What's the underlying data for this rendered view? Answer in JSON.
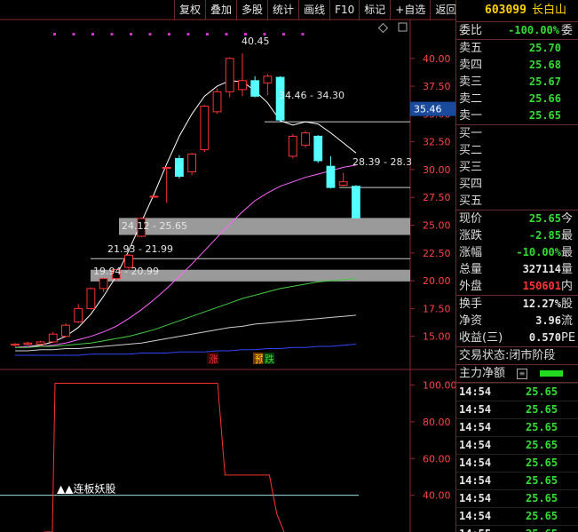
{
  "toolbar": {
    "buttons": [
      "复权",
      "叠加",
      "多股",
      "统计",
      "画线",
      "F10",
      "标记",
      "+自选",
      "返回"
    ]
  },
  "stock": {
    "code": "603099",
    "name": "长白山"
  },
  "order_book": {
    "ratio_label": "委比",
    "ratio_value": "-100.00%",
    "ratio_extra": "委",
    "asks": [
      {
        "label": "卖五",
        "price": "25.70"
      },
      {
        "label": "卖四",
        "price": "25.68"
      },
      {
        "label": "卖三",
        "price": "25.67"
      },
      {
        "label": "卖二",
        "price": "25.66"
      },
      {
        "label": "卖一",
        "price": "25.65"
      }
    ],
    "bids": [
      {
        "label": "买一",
        "price": ""
      },
      {
        "label": "买二",
        "price": ""
      },
      {
        "label": "买三",
        "price": ""
      },
      {
        "label": "买四",
        "price": ""
      },
      {
        "label": "买五",
        "price": ""
      }
    ]
  },
  "quote": [
    {
      "label": "现价",
      "value": "25.65",
      "extra": "今",
      "cls": "dn"
    },
    {
      "label": "涨跌",
      "value": "-2.85",
      "extra": "最",
      "cls": "dn"
    },
    {
      "label": "涨幅",
      "value": "-10.00%",
      "extra": "最",
      "cls": "dn"
    },
    {
      "label": "总量",
      "value": "327114",
      "extra": "量",
      "cls": "wh"
    },
    {
      "label": "外盘",
      "value": "150601",
      "extra": "内",
      "cls": "up"
    }
  ],
  "stats": [
    {
      "label": "换手",
      "value": "12.27%",
      "extra": "股"
    },
    {
      "label": "净资",
      "value": "3.96",
      "extra": "流"
    },
    {
      "label": "收益(三)",
      "value": "0.570",
      "extra": "PE"
    }
  ],
  "status_label": "交易状态:",
  "status_value": "闭市阶段",
  "flow_label": "主力净额",
  "colors": {
    "up": "#ff3333",
    "down": "#33dd33",
    "accent": "#ffd200",
    "border": "#6b2a2a"
  },
  "ticks": [
    {
      "time": "14:54",
      "price": "25.65"
    },
    {
      "time": "14:54",
      "price": "25.65"
    },
    {
      "time": "14:54",
      "price": "25.65"
    },
    {
      "time": "14:54",
      "price": "25.65"
    },
    {
      "time": "14:54",
      "price": "25.65"
    },
    {
      "time": "14:54",
      "price": "25.65"
    },
    {
      "time": "14:54",
      "price": "25.65"
    },
    {
      "time": "14:54",
      "price": "25.65"
    },
    {
      "time": "14:55",
      "price": "25.65"
    }
  ],
  "chart_data": {
    "type": "candlestick",
    "ylim": [
      12.5,
      41.5
    ],
    "yticks": [
      "15.00",
      "17.50",
      "20.00",
      "22.50",
      "25.00",
      "27.50",
      "30.00",
      "32.50",
      "35.00",
      "37.50",
      "40.00"
    ],
    "current_price_tag": "35.46",
    "candles": [
      {
        "o": 14.2,
        "c": 14.3,
        "h": 14.4,
        "l": 14.1
      },
      {
        "o": 14.3,
        "c": 14.4,
        "h": 14.5,
        "l": 14.2
      },
      {
        "o": 14.3,
        "c": 14.5,
        "h": 14.6,
        "l": 14.2
      },
      {
        "o": 14.5,
        "c": 15.2,
        "h": 15.4,
        "l": 14.4
      },
      {
        "o": 15.0,
        "c": 16.0,
        "h": 16.2,
        "l": 14.9
      },
      {
        "o": 16.3,
        "c": 17.5,
        "h": 17.9,
        "l": 16.2
      },
      {
        "o": 17.5,
        "c": 19.3,
        "h": 19.4,
        "l": 17.4
      },
      {
        "o": 19.3,
        "c": 20.2,
        "h": 20.3,
        "l": 19.0
      },
      {
        "o": 20.2,
        "c": 21.0,
        "h": 21.0,
        "l": 20.0
      },
      {
        "o": 21.2,
        "c": 22.3,
        "h": 22.4,
        "l": 21.0
      },
      {
        "o": 24.0,
        "c": 25.6,
        "h": 25.7,
        "l": 23.9
      },
      {
        "o": 27.6,
        "c": 27.6,
        "h": 27.6,
        "l": 27.6
      },
      {
        "o": 30.2,
        "c": 30.2,
        "h": 30.2,
        "l": 27.0
      },
      {
        "o": 31.0,
        "c": 29.4,
        "h": 31.3,
        "l": 29.2
      },
      {
        "o": 29.8,
        "c": 31.4,
        "h": 31.5,
        "l": 29.5
      },
      {
        "o": 31.8,
        "c": 35.7,
        "h": 35.8,
        "l": 31.6
      },
      {
        "o": 35.2,
        "c": 37.0,
        "h": 37.3,
        "l": 35.0
      },
      {
        "o": 37.0,
        "c": 40.0,
        "h": 40.1,
        "l": 36.5
      },
      {
        "o": 37.2,
        "c": 38.0,
        "h": 40.45,
        "l": 36.6
      },
      {
        "o": 38.0,
        "c": 36.6,
        "h": 38.4,
        "l": 36.5
      },
      {
        "o": 37.8,
        "c": 38.4,
        "h": 38.6,
        "l": 36.7
      },
      {
        "o": 38.3,
        "c": 34.46,
        "h": 38.4,
        "l": 34.3
      },
      {
        "o": 31.2,
        "c": 33.0,
        "h": 33.2,
        "l": 31.0
      },
      {
        "o": 32.2,
        "c": 33.3,
        "h": 33.5,
        "l": 32.0
      },
      {
        "o": 33.0,
        "c": 30.8,
        "h": 33.1,
        "l": 30.6
      },
      {
        "o": 30.3,
        "c": 28.39,
        "h": 31.2,
        "l": 28.3
      },
      {
        "o": 28.6,
        "c": 28.9,
        "h": 29.7,
        "l": 28.5
      },
      {
        "o": 28.5,
        "c": 25.65,
        "h": 28.6,
        "l": 25.65
      }
    ],
    "annotations": [
      "40.45",
      "34.46 - 34.30",
      "28.39 - 28.3",
      "24.12 - 25.65",
      "21.93 - 21.99",
      "19.94 - 20.99"
    ],
    "bands": [
      {
        "from": 24.12,
        "to": 25.65
      },
      {
        "from": 19.94,
        "to": 20.99
      }
    ],
    "ref_lines": [
      34.3,
      28.39,
      21.99
    ],
    "ma_lines": [
      {
        "color": "#ffffff",
        "values": [
          14.0,
          14.1,
          14.2,
          14.5,
          15.0,
          15.8,
          17.0,
          18.6,
          20.4,
          22.7,
          25.3,
          27.8,
          30.5,
          33.0,
          35.0,
          36.6,
          37.5,
          38.0,
          37.9,
          37.1,
          36.0,
          34.4,
          34.0,
          34.3,
          34.1,
          33.3,
          32.4,
          31.5
        ]
      },
      {
        "color": "#ff66ff",
        "values": [
          14.0,
          14.1,
          14.1,
          14.2,
          14.4,
          14.7,
          15.0,
          15.4,
          15.9,
          16.6,
          17.4,
          18.3,
          19.3,
          20.4,
          21.5,
          22.7,
          23.9,
          25.1,
          26.2,
          27.2,
          27.9,
          28.5,
          28.9,
          29.3,
          29.6,
          29.9,
          30.2,
          30.4
        ]
      },
      {
        "color": "#44cc44",
        "values": [
          14.0,
          14.0,
          14.1,
          14.1,
          14.2,
          14.3,
          14.4,
          14.6,
          14.8,
          15.0,
          15.3,
          15.6,
          16.0,
          16.4,
          16.8,
          17.2,
          17.6,
          18.0,
          18.4,
          18.7,
          19.0,
          19.3,
          19.5,
          19.7,
          19.9,
          20.0,
          20.1,
          20.2
        ]
      },
      {
        "color": "#cfcfcf",
        "values": [
          13.7,
          13.7,
          13.8,
          13.8,
          13.9,
          13.9,
          14.0,
          14.1,
          14.2,
          14.3,
          14.4,
          14.6,
          14.8,
          15.0,
          15.2,
          15.4,
          15.6,
          15.8,
          15.9,
          16.1,
          16.2,
          16.3,
          16.4,
          16.5,
          16.6,
          16.7,
          16.8,
          16.9
        ]
      },
      {
        "color": "#3344ff",
        "values": [
          13.3,
          13.3,
          13.3,
          13.3,
          13.3,
          13.3,
          13.4,
          13.4,
          13.4,
          13.4,
          13.5,
          13.5,
          13.5,
          13.6,
          13.6,
          13.6,
          13.7,
          13.7,
          13.8,
          13.8,
          13.9,
          13.9,
          14.0,
          14.0,
          14.1,
          14.1,
          14.2,
          14.3
        ]
      }
    ],
    "signals": [
      "涨",
      "预",
      "跌"
    ],
    "indicator": {
      "yticks": [
        "40.00",
        "60.00",
        "80.00",
        "100.00"
      ],
      "ylim": [
        20,
        108
      ],
      "values": [
        20,
        20,
        20,
        20,
        101,
        101,
        101,
        101,
        101,
        101,
        101,
        101,
        101,
        101,
        101,
        101,
        101,
        101,
        101,
        101,
        101,
        101,
        101,
        101,
        101,
        101,
        101,
        51,
        51,
        51,
        51,
        51,
        51,
        51,
        30,
        20
      ],
      "label": "▲▲连板妖股"
    }
  }
}
